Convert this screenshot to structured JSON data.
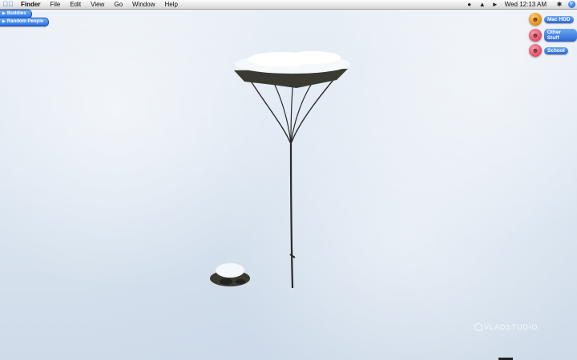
{
  "menubar": {
    "app_name": "Finder",
    "items": [
      "File",
      "Edit",
      "View",
      "Go",
      "Window",
      "Help"
    ],
    "clock": "Wed 12:13 AM",
    "status_icons": [
      "user-icon",
      "wifi-icon",
      "volume-icon",
      "bluetooth-icon"
    ]
  },
  "drawers": [
    {
      "label": "Buddies"
    },
    {
      "label": "Random People"
    }
  ],
  "desktop_icons": [
    {
      "label": "Mac HDD",
      "icon": "hard-drive-icon"
    },
    {
      "label": "Other Stuff",
      "icon": "folder-disk-icon"
    },
    {
      "label": "School",
      "icon": "folder-disk-icon"
    }
  ],
  "watermark": "VLADSTUDIO",
  "colors": {
    "menu_accent": "#2a6fd6",
    "label_blue": "#2c66cf",
    "hdd_orange": "#e08a10",
    "disk_pink": "#e34b66"
  }
}
